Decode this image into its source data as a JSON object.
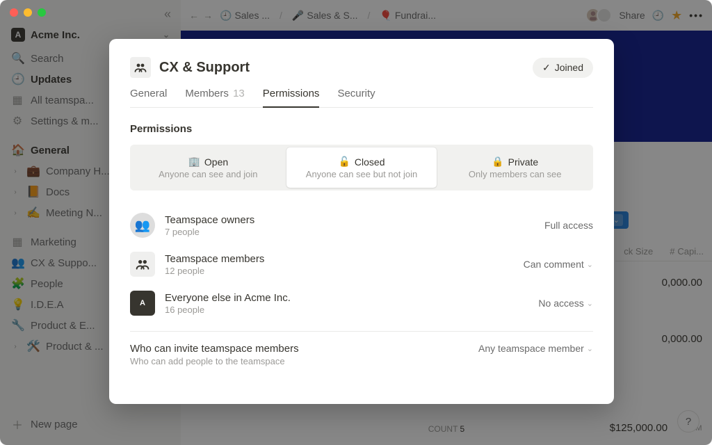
{
  "workspace": {
    "name": "Acme Inc."
  },
  "sidebar": {
    "search": "Search",
    "updates": "Updates",
    "all_teamspaces": "All teamspa...",
    "settings": "Settings & m...",
    "sections": {
      "general": "General",
      "general_items": [
        {
          "emoji": "💼",
          "label": "Company H..."
        },
        {
          "emoji": "📙",
          "label": "Docs"
        },
        {
          "emoji": "✍️",
          "label": "Meeting N..."
        }
      ],
      "teamspaces": [
        {
          "icon": "grid",
          "label": "Marketing"
        },
        {
          "icon": "people",
          "label": "CX & Suppo..."
        },
        {
          "icon": "puzzle",
          "label": "People"
        },
        {
          "icon": "bulb",
          "label": "I.D.E.A"
        },
        {
          "icon": "wrench",
          "label": "Product & E..."
        },
        {
          "icon": "tools",
          "label": "Product & ..."
        }
      ]
    },
    "new_page": "New page"
  },
  "topbar": {
    "crumbs": [
      {
        "emoji": "🕘",
        "label": "Sales ..."
      },
      {
        "emoji": "🎤",
        "label": "Sales & S..."
      },
      {
        "emoji": "🎈",
        "label": "Fundrai..."
      }
    ],
    "share": "Share"
  },
  "table": {
    "headers": [
      "ck Size",
      "Capi..."
    ],
    "values": [
      "0,000.00",
      "0,000.00"
    ],
    "sum": "$125,000.00",
    "sum_label": "SUM",
    "count_label": "COUNT",
    "count": "5"
  },
  "modal": {
    "title": "CX & Support",
    "joined": "Joined",
    "tabs": {
      "general": "General",
      "members": "Members",
      "members_count": "13",
      "permissions": "Permissions",
      "security": "Security"
    },
    "section": "Permissions",
    "seg": {
      "open": {
        "t": "Open",
        "d": "Anyone can see and join"
      },
      "closed": {
        "t": "Closed",
        "d": "Anyone can see but not join"
      },
      "private": {
        "t": "Private",
        "d": "Only members can see"
      }
    },
    "rows": [
      {
        "name": "Teamspace owners",
        "sub": "7 people",
        "value": "Full access",
        "chev": false
      },
      {
        "name": "Teamspace members",
        "sub": "12 people",
        "value": "Can comment",
        "chev": true
      },
      {
        "name": "Everyone else in Acme Inc.",
        "sub": "16 people",
        "value": "No access",
        "chev": true
      }
    ],
    "invite": {
      "title": "Who can invite teamspace members",
      "sub": "Who can add people to the teamspace",
      "value": "Any teamspace member"
    }
  }
}
